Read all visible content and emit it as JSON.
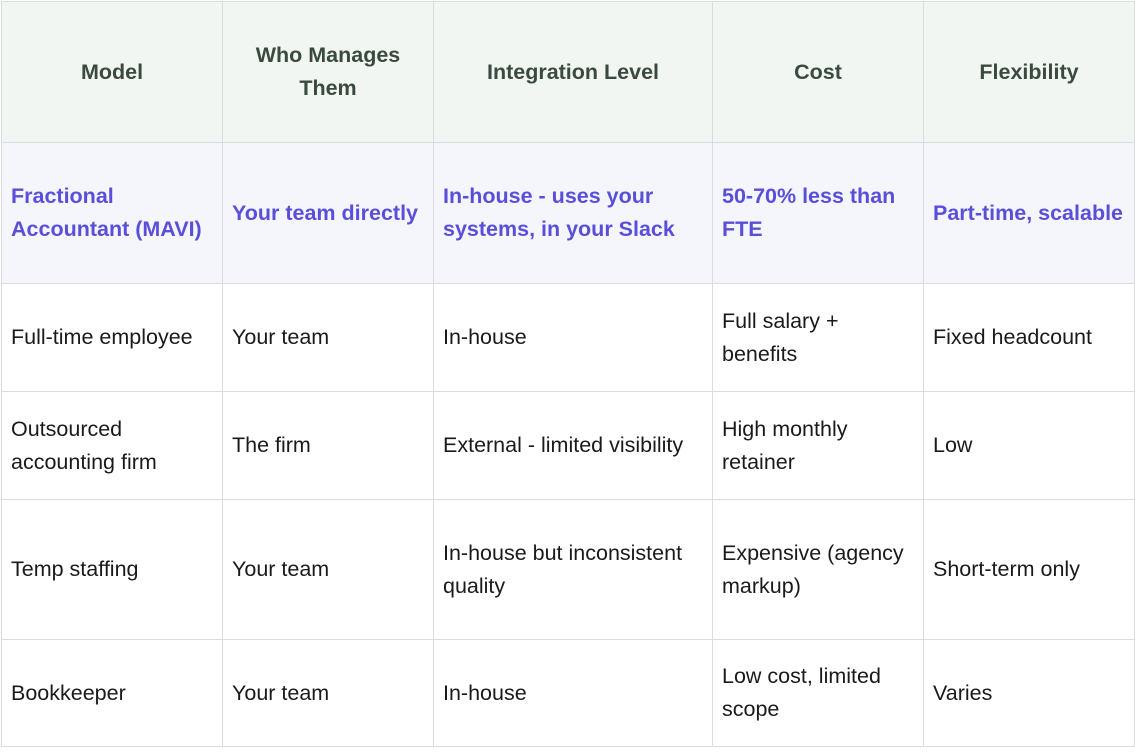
{
  "table": {
    "headers": [
      "Model",
      "Who Manages Them",
      "Integration Level",
      "Cost",
      "Flexibility"
    ],
    "featured_row": [
      "Fractional Accountant (MAVI)",
      "Your team directly",
      "In-house - uses your systems, in your Slack",
      "50-70% less than FTE",
      "Part-time, scalable"
    ],
    "rows": [
      [
        "Full-time employee",
        "Your team",
        "In-house",
        "Full salary + benefits",
        "Fixed headcount"
      ],
      [
        "Outsourced accounting firm",
        "The firm",
        "External - limited visibility",
        "High monthly retainer",
        "Low"
      ],
      [
        "Temp staffing",
        "Your team",
        "In-house but inconsistent quality",
        "Expensive (agency markup)",
        "Short-term only"
      ],
      [
        "Bookkeeper",
        "Your team",
        "In-house",
        "Low cost, limited scope",
        "Varies"
      ]
    ]
  },
  "colors": {
    "header_bg": "#f1f6f3",
    "header_text": "#3a4a3e",
    "featured_bg": "#f5f5fc",
    "featured_text": "#5a4fd8",
    "border": "#dcdcdc"
  }
}
